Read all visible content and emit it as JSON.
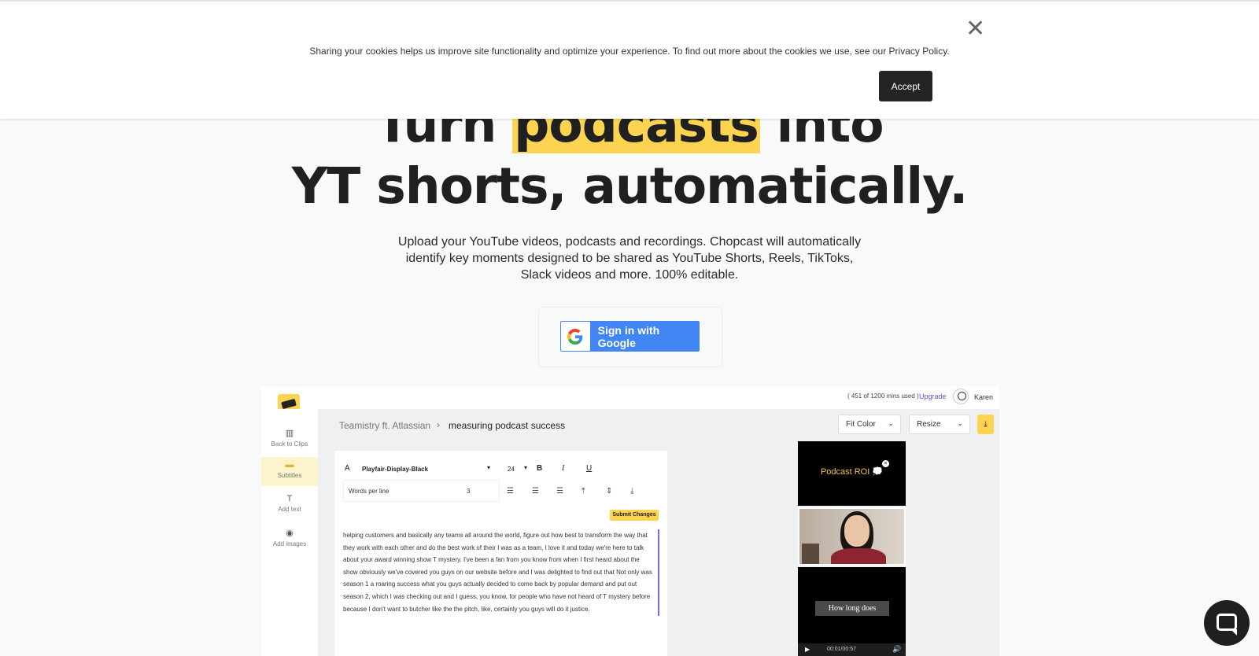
{
  "cookie_banner": {
    "message": "Sharing your cookies helps us improve site functionality and optimize your experience. To find out more about the cookies we use, see our Privacy Policy.",
    "accept_label": "Accept",
    "close_icon": "close-icon",
    "close_glyph": "✕"
  },
  "hero": {
    "title_prefix": "Turn ",
    "title_highlight": "podcasts",
    "title_suffix": " into",
    "title_line2": "YT shorts, automatically.",
    "subtitle": "Upload your YouTube videos, podcasts and recordings. Chopcast will automatically identify key moments designed to be shared as YouTube Shorts, Reels, TikToks, Slack videos and more. 100% editable.",
    "highlight_color": "#fcd451",
    "google_button_label": "Sign in with Google",
    "google_button_color": "#4285f4"
  },
  "app_preview": {
    "usage": "( 451 of 1200 mins used )",
    "upgrade_label": "Upgrade",
    "username": "Karen",
    "sidebar": [
      {
        "label": "Back to Clips",
        "icon": "clips-icon",
        "glyph": "▥"
      },
      {
        "label": "Subtitles",
        "icon": "subtitles-icon",
        "glyph": "▬"
      },
      {
        "label": "Add text",
        "icon": "text-icon",
        "glyph": "T"
      },
      {
        "label": "Add images",
        "icon": "camera-icon",
        "glyph": "◉"
      }
    ],
    "breadcrumb": {
      "parent": "Teamistry ft. Atlassian",
      "separator": "›",
      "current": "measuring podcast success"
    },
    "fit_color_label": "Fit Color",
    "resize_label": "Resize",
    "editor": {
      "font_icon_label": "A",
      "font": "Playfair-Display-Black",
      "size": "24",
      "bold": "B",
      "italic": "I",
      "underline": "U",
      "words_per_line_label": "Words per line",
      "words_per_line_value": "3",
      "submit_label": "Submit Changes",
      "transcript": "helping customers and basically any teams all around the world, figure out how best to transform the way that they work with each other and do the best work of their I was as a team, I love it and today we're here to talk about your award winning show T mystery. I've been a fan from you know from when I first heard about the show obviously we've covered you guys on our website before and I was delighted to find out that Not only was season 1 a roaring success what you guys actually decided to come back by popular demand and put out season 2, which I was checking out and I guess, you know, for people who have not heard of T mystery before because I don't want to butcher like the the pitch, like, certainly you guys will do it justice."
    },
    "preview": {
      "clip1_text": "Podcast ROI",
      "clip1_emoji": "💭",
      "clip3_caption": "How long does",
      "timestamp": "00:01/00:57"
    }
  },
  "chat_widget": {
    "icon": "chat-icon"
  }
}
